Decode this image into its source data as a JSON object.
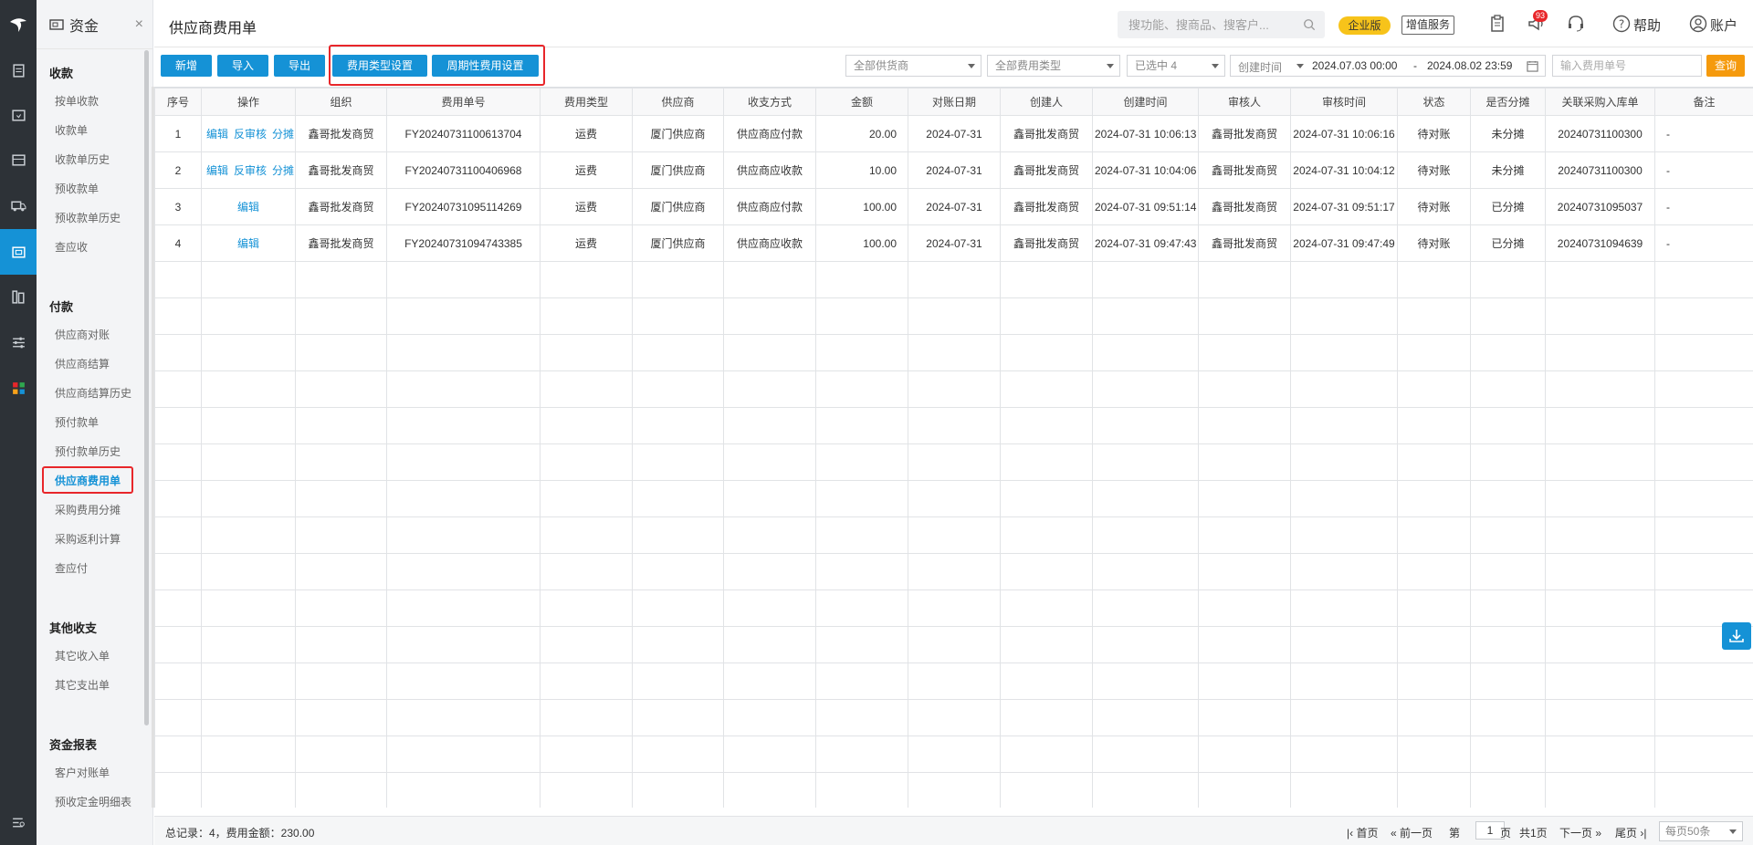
{
  "sidebar": {
    "title": "资金",
    "close_glyph": "×",
    "groups": [
      {
        "label": "收款",
        "items": [
          "按单收款",
          "收款单",
          "收款单历史",
          "预收款单",
          "预收款单历史",
          "查应收"
        ]
      },
      {
        "label": "付款",
        "items": [
          "供应商对账",
          "供应商结算",
          "供应商结算历史",
          "预付款单",
          "预付款单历史",
          "供应商费用单",
          "采购费用分摊",
          "采购返利计算",
          "查应付"
        ]
      },
      {
        "label": "其他收支",
        "items": [
          "其它收入单",
          "其它支出单"
        ]
      },
      {
        "label": "资金报表",
        "items": [
          "客户对账单",
          "预收定金明细表"
        ]
      }
    ],
    "active_item": "供应商费用单"
  },
  "header": {
    "title": "供应商费用单",
    "search_placeholder": "搜功能、搜商品、搜客户...",
    "edition_badge": "企业版",
    "value_added": "增值服务",
    "notification_count": "93",
    "help": "帮助",
    "account": "账户"
  },
  "toolbar": {
    "buttons": [
      "新增",
      "导入",
      "导出",
      "费用类型设置",
      "周期性费用设置"
    ],
    "filter_supplier": "全部供货商",
    "filter_fee_type": "全部费用类型",
    "filter_selected": "已选中 4",
    "date_type": "创建时间",
    "date_from": "2024.07.03 00:00",
    "date_sep": "-",
    "date_to": "2024.08.02 23:59",
    "doc_no_placeholder": "输入费用单号",
    "query": "查询"
  },
  "table": {
    "columns": [
      "序号",
      "操作",
      "组织",
      "费用单号",
      "费用类型",
      "供应商",
      "收支方式",
      "金额",
      "对账日期",
      "创建人",
      "创建时间",
      "审核人",
      "审核时间",
      "状态",
      "是否分摊",
      "关联采购入库单",
      "备注"
    ],
    "rows": [
      {
        "no": "1",
        "ops": [
          "编辑",
          "反审核",
          "分摊"
        ],
        "org": "鑫哥批发商贸",
        "doc": "FY20240731100613704",
        "type": "运费",
        "supplier": "厦门供应商",
        "mode": "供应商应付款",
        "amount": "20.00",
        "recon": "2024-07-31",
        "creator": "鑫哥批发商贸",
        "ctime": "2024-07-31 10:06:13",
        "auditor": "鑫哥批发商贸",
        "atime": "2024-07-31 10:06:16",
        "status": "待对账",
        "alloc": "未分摊",
        "link": "20240731100300",
        "remark": "-"
      },
      {
        "no": "2",
        "ops": [
          "编辑",
          "反审核",
          "分摊"
        ],
        "org": "鑫哥批发商贸",
        "doc": "FY20240731100406968",
        "type": "运费",
        "supplier": "厦门供应商",
        "mode": "供应商应收款",
        "amount": "10.00",
        "recon": "2024-07-31",
        "creator": "鑫哥批发商贸",
        "ctime": "2024-07-31 10:04:06",
        "auditor": "鑫哥批发商贸",
        "atime": "2024-07-31 10:04:12",
        "status": "待对账",
        "alloc": "未分摊",
        "link": "20240731100300",
        "remark": "-"
      },
      {
        "no": "3",
        "ops": [
          "编辑"
        ],
        "org": "鑫哥批发商贸",
        "doc": "FY20240731095114269",
        "type": "运费",
        "supplier": "厦门供应商",
        "mode": "供应商应付款",
        "amount": "100.00",
        "recon": "2024-07-31",
        "creator": "鑫哥批发商贸",
        "ctime": "2024-07-31 09:51:14",
        "auditor": "鑫哥批发商贸",
        "atime": "2024-07-31 09:51:17",
        "status": "待对账",
        "alloc": "已分摊",
        "link": "20240731095037",
        "remark": "-"
      },
      {
        "no": "4",
        "ops": [
          "编辑"
        ],
        "org": "鑫哥批发商贸",
        "doc": "FY20240731094743385",
        "type": "运费",
        "supplier": "厦门供应商",
        "mode": "供应商应收款",
        "amount": "100.00",
        "recon": "2024-07-31",
        "creator": "鑫哥批发商贸",
        "ctime": "2024-07-31 09:47:43",
        "auditor": "鑫哥批发商贸",
        "atime": "2024-07-31 09:47:49",
        "status": "待对账",
        "alloc": "已分摊",
        "link": "20240731094639",
        "remark": "-"
      }
    ]
  },
  "footer": {
    "summary": "总记录：4，费用金额：230.00",
    "first": "首页",
    "prev": "前一页",
    "page_prefix": "第",
    "page_value": "1",
    "page_suffix": "页",
    "total_pages": "共1页",
    "next": "下一页",
    "last": "尾页",
    "page_size": "每页50条"
  }
}
